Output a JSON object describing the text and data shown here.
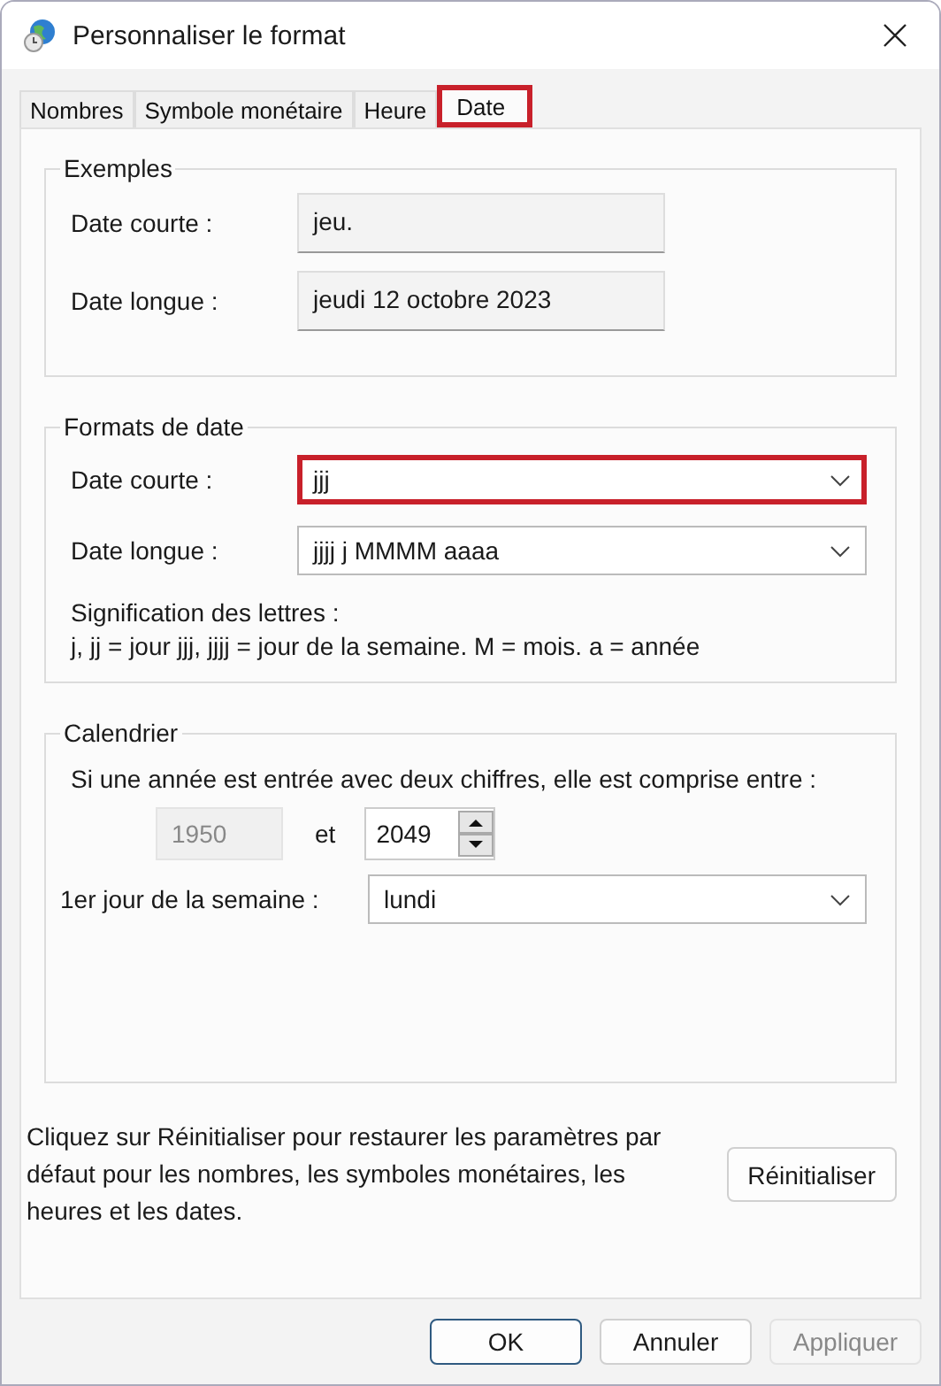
{
  "window": {
    "title": "Personnaliser le format"
  },
  "tabs": [
    {
      "label": "Nombres",
      "selected": false,
      "highlighted": false
    },
    {
      "label": "Symbole monétaire",
      "selected": false,
      "highlighted": false
    },
    {
      "label": "Heure",
      "selected": false,
      "highlighted": false
    },
    {
      "label": "Date",
      "selected": true,
      "highlighted": true
    }
  ],
  "examples": {
    "title": "Exemples",
    "rows": [
      {
        "label": "Date courte :",
        "value": "jeu."
      },
      {
        "label": "Date longue :",
        "value": "jeudi 12 octobre 2023"
      }
    ]
  },
  "date_formats": {
    "title": "Formats de date",
    "rows": [
      {
        "label": "Date courte :",
        "value": "jjj",
        "highlighted": true
      },
      {
        "label": "Date longue :",
        "value": "jjjj j MMMM aaaa",
        "highlighted": false
      }
    ],
    "legend_title": "Signification des lettres :",
    "legend": "j, jj = jour  jjj, jjjj = jour de la semaine. M = mois. a = année"
  },
  "calendar": {
    "title": "Calendrier",
    "note": "Si une année est entrée avec deux chiffres, elle est comprise entre :",
    "year_from": {
      "value": "1950",
      "disabled": true
    },
    "and": "et",
    "year_to": {
      "value": "2049",
      "disabled": false
    },
    "first_day_label": "1er jour de la semaine :",
    "first_day": "lundi"
  },
  "reset_text": "Cliquez sur Réinitialiser pour restaurer les paramètres par défaut pour les nombres, les symboles monétaires, les heures et les dates.",
  "reset_button": "Réinitialiser",
  "buttons": [
    {
      "label": "OK",
      "kind": "default",
      "disabled": false
    },
    {
      "label": "Annuler",
      "kind": "normal",
      "disabled": false
    },
    {
      "label": "Appliquer",
      "kind": "normal",
      "disabled": true
    }
  ]
}
